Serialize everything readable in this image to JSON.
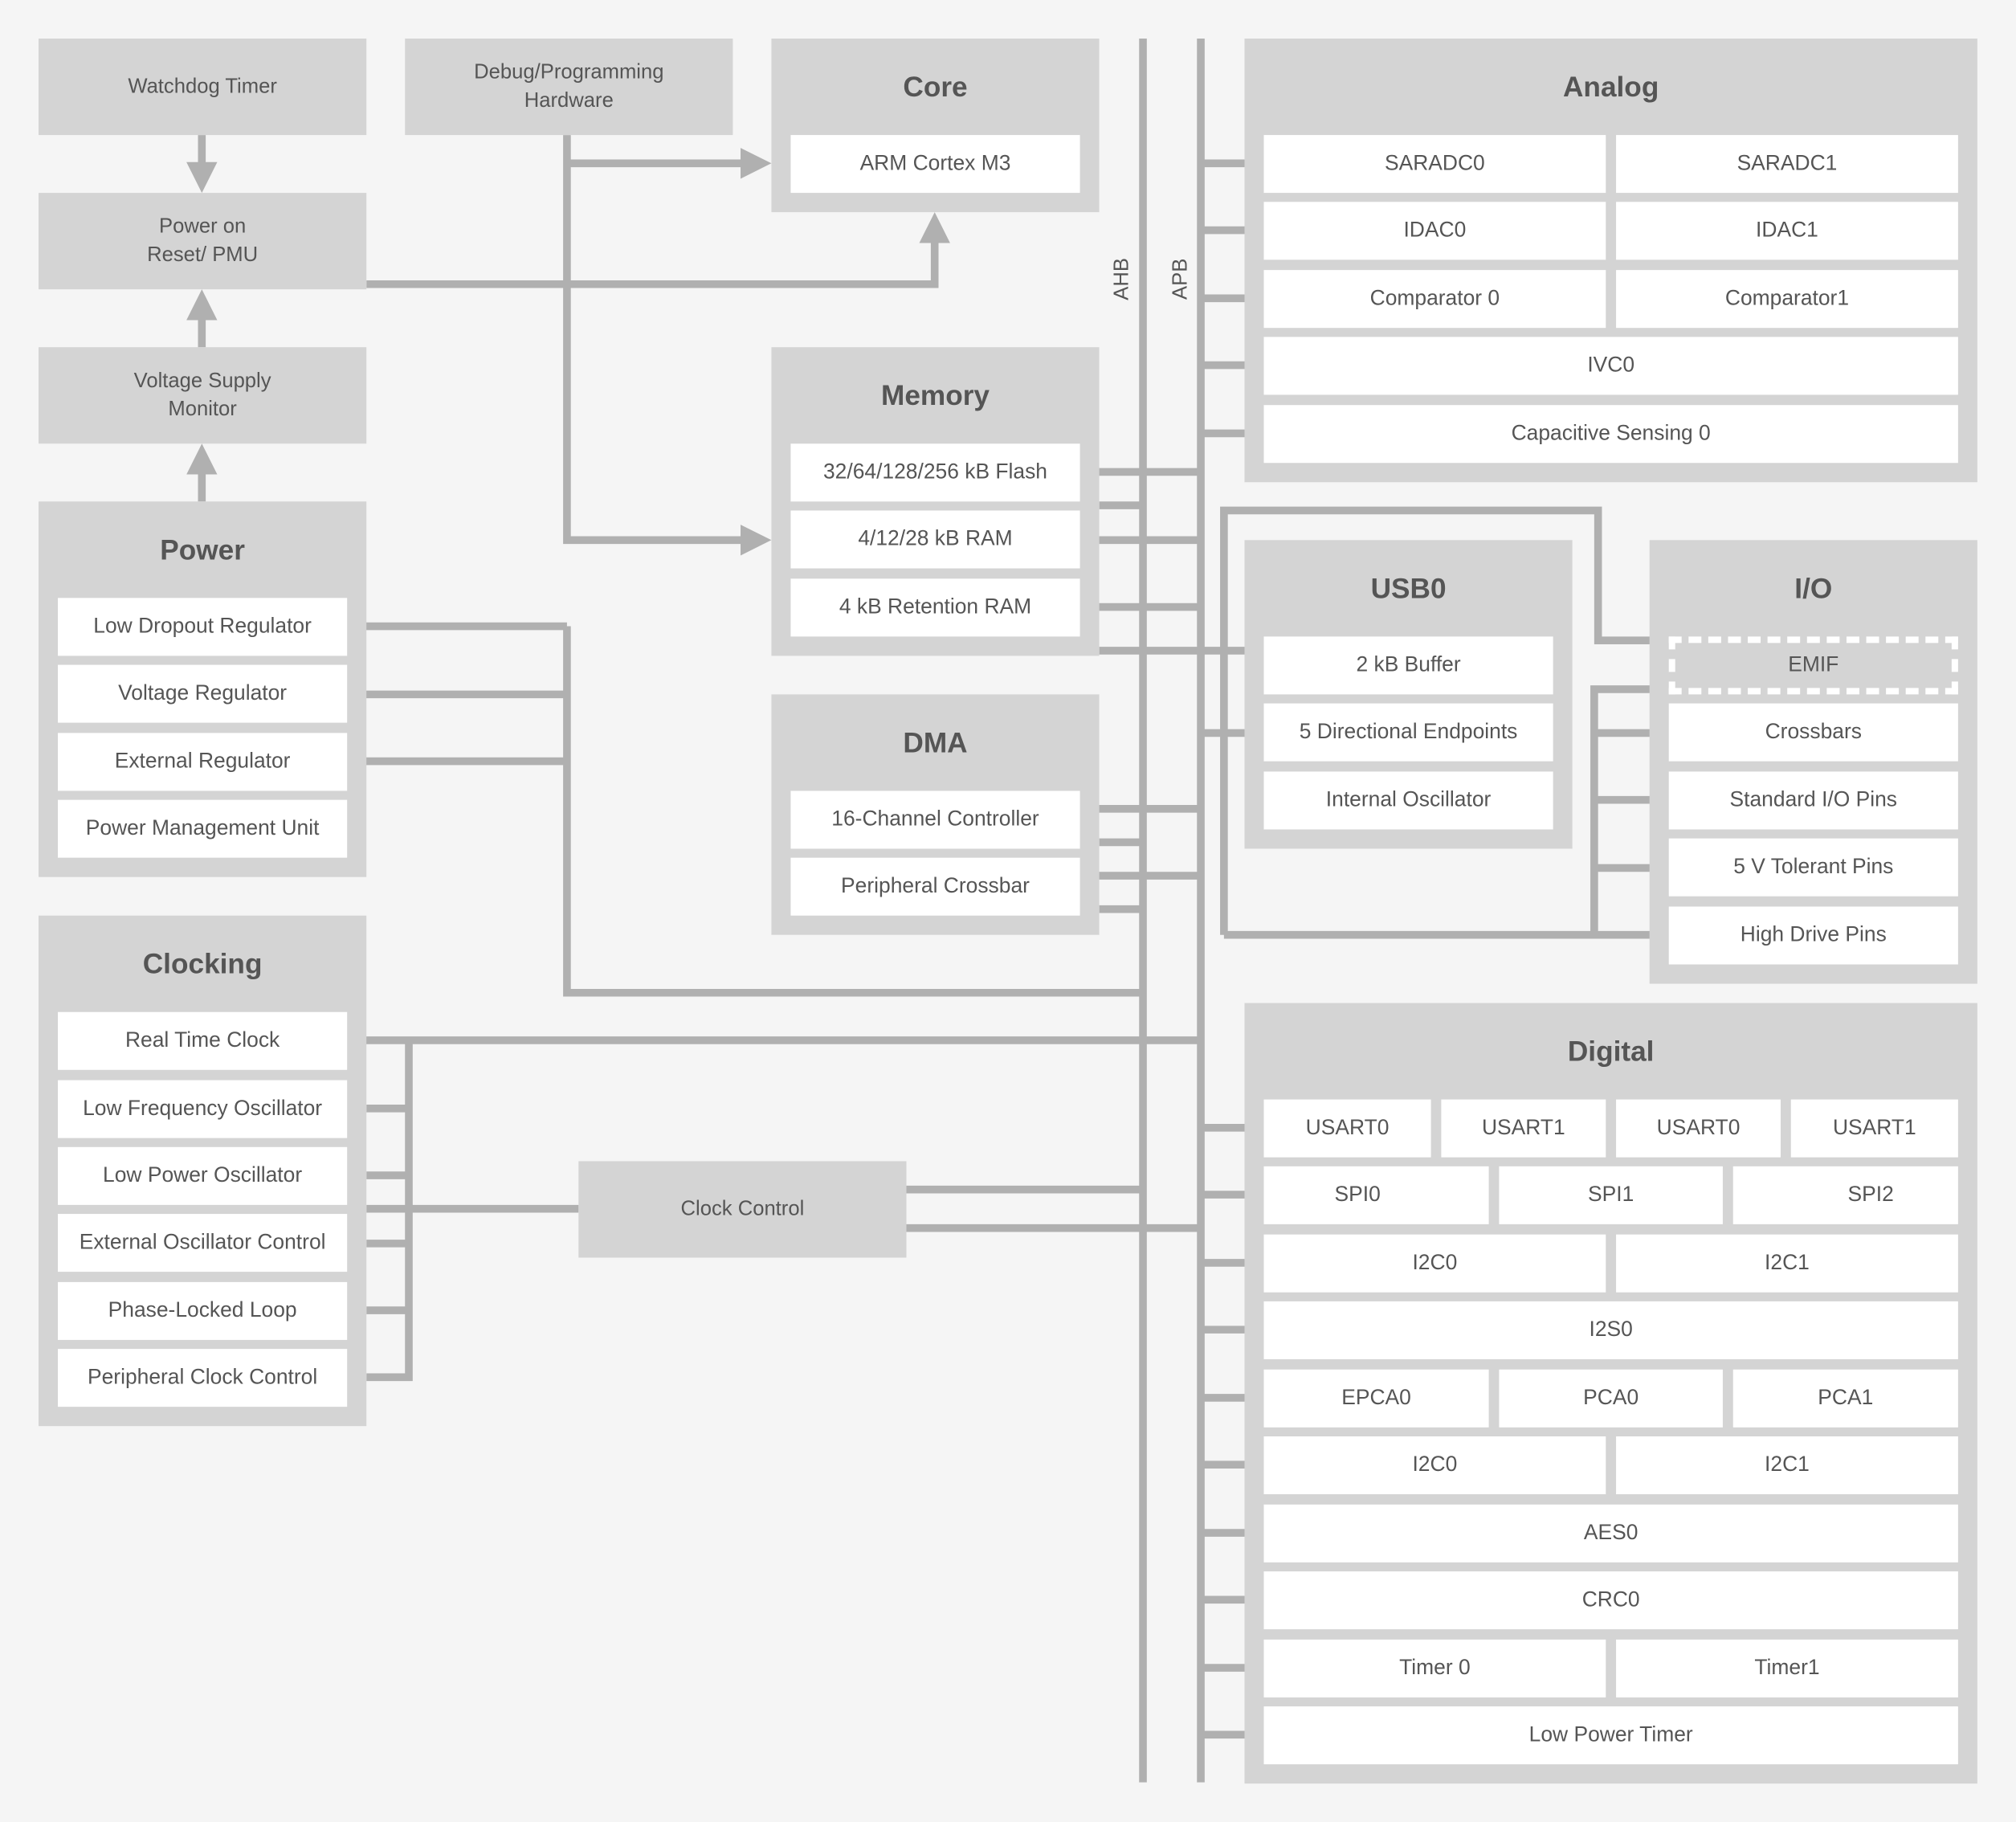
{
  "colors": {
    "background": "#f5f5f5",
    "block": "#d4d4d4",
    "connector": "#b0b0b0",
    "text": "#555555"
  },
  "watchdog": "Watchdog Timer",
  "debug": "Debug/Programming Hardware",
  "por": "Power on Reset/ PMU",
  "vsm": "Voltage Supply Monitor",
  "clock_control": "Clock Control",
  "buses": {
    "ahb": "AHB",
    "apb": "APB"
  },
  "core": {
    "title": "Core",
    "items": [
      "ARM Cortex M3"
    ]
  },
  "memory": {
    "title": "Memory",
    "items": [
      "32/64/128/256 kB Flash",
      "4/12/28 kB RAM",
      "4 kB Retention RAM"
    ]
  },
  "dma": {
    "title": "DMA",
    "items": [
      "16-Channel Controller",
      "Peripheral Crossbar"
    ]
  },
  "power": {
    "title": "Power",
    "items": [
      "Low Dropout Regulator",
      "Voltage Regulator",
      "External Regulator",
      "Power Management Unit"
    ]
  },
  "clocking": {
    "title": "Clocking",
    "items": [
      "Real Time Clock",
      "Low Frequency Oscillator",
      "Low Power Oscillator",
      "External Oscillator Control",
      "Phase-Locked Loop",
      "Peripheral Clock Control"
    ]
  },
  "analog": {
    "title": "Analog",
    "items": [
      "SARADC0",
      "SARADC1",
      "IDAC0",
      "IDAC1",
      "Comparator 0",
      "Comparator1",
      "IVC0",
      "Capacitive Sensing 0"
    ]
  },
  "usb": {
    "title": "USB0",
    "items": [
      "2 kB Buffer",
      "5 Directional Endpoints",
      "Internal Oscillator"
    ]
  },
  "io": {
    "title": "I/O",
    "items": [
      "EMIF",
      "Crossbars",
      "Standard I/O Pins",
      "5 V Tolerant Pins",
      "High Drive Pins"
    ]
  },
  "digital": {
    "title": "Digital",
    "items": [
      "USART0",
      "USART1",
      "USART0",
      "USART1",
      "SPI0",
      "SPI1",
      "SPI2",
      "I2C0",
      "I2C1",
      "I2S0",
      "EPCA0",
      "PCA0",
      "PCA1",
      "I2C0",
      "I2C1",
      "AES0",
      "CRC0",
      "Timer 0",
      "Timer1",
      "Low Power Timer"
    ]
  }
}
